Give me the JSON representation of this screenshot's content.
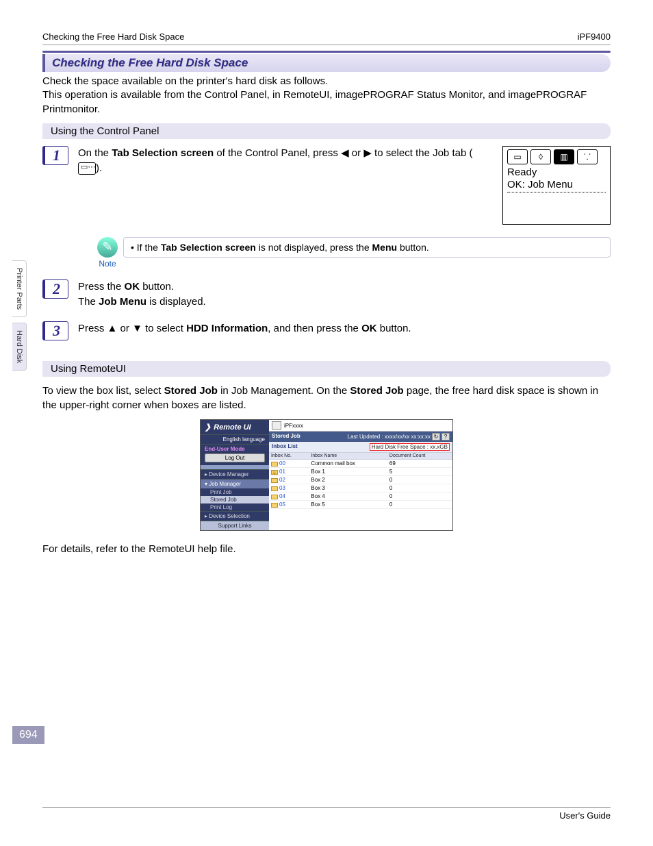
{
  "header": {
    "left": "Checking the Free Hard Disk Space",
    "right": "iPF9400"
  },
  "side_tabs": {
    "tab1": "Printer Parts",
    "tab2": "Hard Disk"
  },
  "page_number": "694",
  "section": {
    "title": "Checking the Free Hard Disk Space",
    "intro": "Check the space available on the printer's hard disk as follows.\nThis operation is available from the Control Panel, in RemoteUI, imagePROGRAF Status Monitor, and imagePROGRAF Printmonitor."
  },
  "sub1": {
    "title": "Using the Control Panel"
  },
  "step1": {
    "num": "1",
    "pre": "On the ",
    "b1": "Tab Selection screen",
    "mid1": " of the Control Panel, press ",
    "arrL": "◀",
    "mid2": " or ",
    "arrR": "▶",
    "mid3": " to select the Job tab (",
    "post": ")."
  },
  "lcd": {
    "line1": "Ready",
    "line2": "OK: Job Menu"
  },
  "note": {
    "label": "Note",
    "pre": "If the ",
    "b1": "Tab Selection screen",
    "mid": " is not displayed, press the ",
    "b2": "Menu",
    "post": " button."
  },
  "step2": {
    "num": "2",
    "l1a": "Press the ",
    "l1b": "OK",
    "l1c": " button.",
    "l2a": "The ",
    "l2b": "Job Menu",
    "l2c": " is displayed."
  },
  "step3": {
    "num": "3",
    "pre": "Press ",
    "up": "▲",
    "mid1": " or ",
    "down": "▼",
    "mid2": " to select ",
    "b1": "HDD Information",
    "mid3": ", and then press the ",
    "b2": "OK",
    "post": " button."
  },
  "sub2": {
    "title": "Using RemoteUI"
  },
  "remote_para": {
    "pre": "To view the box list, select ",
    "b1": "Stored Job",
    "mid1": " in Job Management. On the ",
    "b2": "Stored Job",
    "post": " page, the free hard disk space is shown in the upper-right corner when boxes are listed."
  },
  "remoteui": {
    "logo": "Remote UI",
    "model": "iPFxxxx",
    "lang": "English language",
    "mode": "End-User Mode",
    "logout": "Log Out",
    "nav": {
      "device": "Device Manager",
      "jobmgr": "Job Manager",
      "printjob": "Print Job",
      "stored": "Stored Job",
      "printlog": "Print Log",
      "devsel": "Device Selection",
      "support": "Support Links"
    },
    "main": {
      "stored_title": "Stored Job",
      "updated": "Last Updated : xxxx/xx/xx xx:xx:xx",
      "inbox_list": "Inbox List",
      "hd_free": "Hard Disk Free Space : xx.xGB",
      "headers": {
        "no": "Inbox No.",
        "name": "Inbox Name",
        "count": "Document Count"
      },
      "rows": [
        {
          "no": "00",
          "name": "Common mail box",
          "count": "69"
        },
        {
          "no": "01",
          "name": "Box 1",
          "count": "5"
        },
        {
          "no": "02",
          "name": "Box 2",
          "count": "0"
        },
        {
          "no": "03",
          "name": "Box 3",
          "count": "0"
        },
        {
          "no": "04",
          "name": "Box 4",
          "count": "0"
        },
        {
          "no": "05",
          "name": "Box 5",
          "count": "0"
        }
      ]
    }
  },
  "remote_footer": "For details, refer to the RemoteUI help file.",
  "footer": "User's Guide"
}
